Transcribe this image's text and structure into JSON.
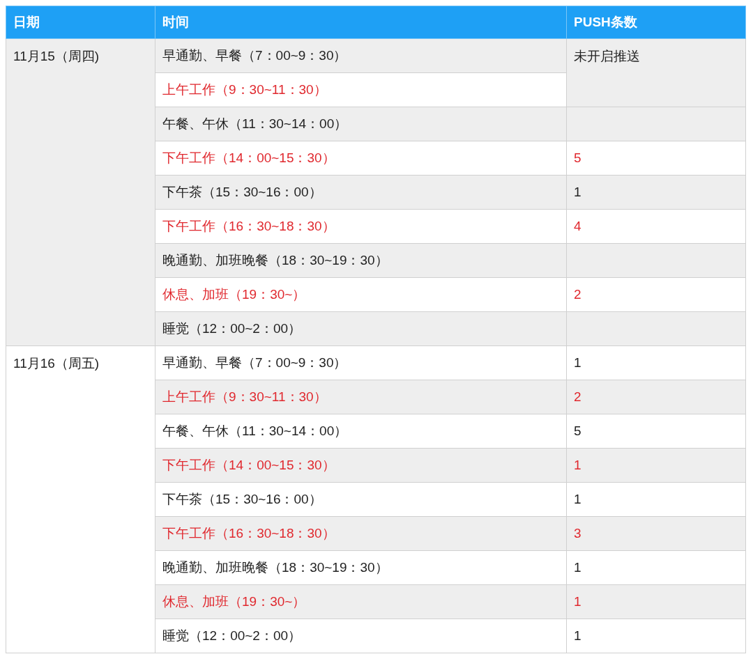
{
  "table": {
    "columns": [
      "日期",
      "时间",
      "PUSH条数"
    ],
    "days": [
      {
        "date": "11月15（周四)",
        "slots": [
          {
            "time": "早通勤、早餐（7：00~9：30）",
            "highlighted": false,
            "push": "未开启推送"
          },
          {
            "time": "上午工作（9：30~11：30）",
            "highlighted": true,
            "merged_above": true
          },
          {
            "time": "午餐、午休（11：30~14：00）",
            "highlighted": false
          },
          {
            "time": "下午工作（14：00~15：30）",
            "highlighted": true,
            "push": "5"
          },
          {
            "time": "下午茶（15：30~16：00）",
            "highlighted": false,
            "push": "1"
          },
          {
            "time": "下午工作（16：30~18：30）",
            "highlighted": true,
            "push": "4"
          },
          {
            "time": "晚通勤、加班晚餐（18：30~19：30）",
            "highlighted": false
          },
          {
            "time": "休息、加班（19：30~）",
            "highlighted": true,
            "push": "2"
          },
          {
            "time": "睡觉（12：00~2：00）",
            "highlighted": false
          }
        ]
      },
      {
        "date": "11月16（周五)",
        "slots": [
          {
            "time": "早通勤、早餐（7：00~9：30）",
            "highlighted": false,
            "push": "1"
          },
          {
            "time": "上午工作（9：30~11：30）",
            "highlighted": true,
            "push": "2"
          },
          {
            "time": "午餐、午休（11：30~14：00）",
            "highlighted": false,
            "push": "5"
          },
          {
            "time": "下午工作（14：00~15：30）",
            "highlighted": true,
            "push": "1"
          },
          {
            "time": "下午茶（15：30~16：00）",
            "highlighted": false,
            "push": "1"
          },
          {
            "time": "下午工作（16：30~18：30）",
            "highlighted": true,
            "push": "3"
          },
          {
            "time": "晚通勤、加班晚餐（18：30~19：30）",
            "highlighted": false,
            "push": "1"
          },
          {
            "time": "休息、加班（19：30~）",
            "highlighted": true,
            "push": "1"
          },
          {
            "time": "睡觉（12：00~2：00）",
            "highlighted": false,
            "push": "1"
          }
        ]
      }
    ]
  }
}
